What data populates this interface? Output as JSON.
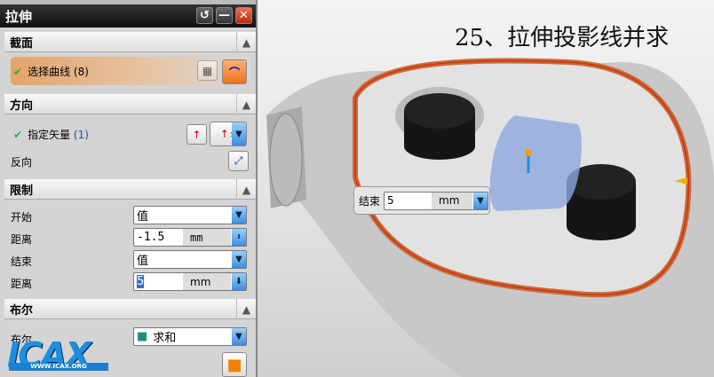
{
  "dialog": {
    "title": "拉伸",
    "reset_icon": "reset-icon",
    "min_icon": "minimize-icon",
    "close_icon": "close-icon"
  },
  "sections": {
    "section": {
      "header": "截面",
      "select_curve": "选择曲线",
      "select_count": "(8)"
    },
    "direction": {
      "header": "方向",
      "vector_label": "指定矢量",
      "vector_count": "(1)",
      "reverse_label": "反向"
    },
    "limits": {
      "header": "限制",
      "start_label": "开始",
      "start_value": "值",
      "start_dist_label": "距离",
      "start_dist": "-1.5",
      "unit": "mm",
      "end_label": "结束",
      "end_value": "值",
      "end_dist_label": "距离",
      "end_dist": "5"
    },
    "boolean": {
      "header": "布尔",
      "bool_label": "布尔",
      "bool_value": "求和"
    }
  },
  "viewport": {
    "title": "25、拉伸投影线并求",
    "float_label": "结束",
    "float_value": "5",
    "float_unit": "mm"
  },
  "watermark": {
    "logo": "ICAX",
    "url": "WWW.ICAX.ORG"
  }
}
